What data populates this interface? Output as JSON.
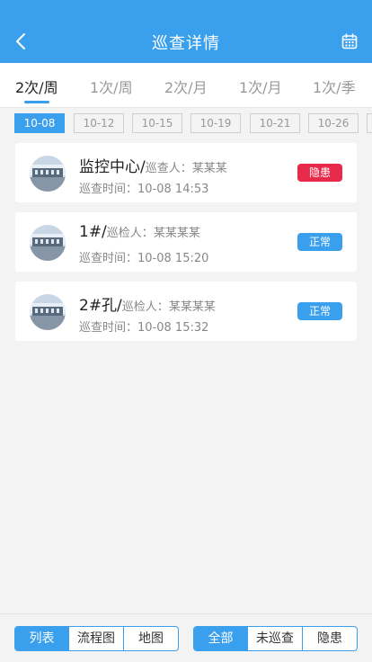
{
  "header": {
    "title": "巡查详情",
    "back_icon": "chevron-left-icon",
    "calendar_icon": "calendar-icon"
  },
  "freq_tabs": [
    "2次/周",
    "1次/周",
    "2次/月",
    "1次/月",
    "1次/季"
  ],
  "active_freq_tab": 0,
  "dates": [
    "10-08",
    "10-12",
    "10-15",
    "10-19",
    "10-21",
    "10-26"
  ],
  "active_date": 0,
  "records": [
    {
      "name": "监控中心/",
      "role_label": "巡查人：",
      "person": "某某某",
      "time_label": "巡查时间：",
      "time": "10-08 14:53",
      "status": "隐患"
    },
    {
      "name": "1#/",
      "role_label": "巡检人：",
      "person": "某某某某",
      "time_label": "巡查时间：",
      "time": "10-08 15:20",
      "status": "正常"
    },
    {
      "name": "2#孔/",
      "role_label": "巡检人：",
      "person": "某某某某",
      "time_label": "巡查时间：",
      "time": "10-08 15:32",
      "status": "正常"
    }
  ],
  "status_colors": {
    "隐患": "#e8294a",
    "正常": "#3aa0ee"
  },
  "view_tabs": [
    "列表",
    "流程图",
    "地图"
  ],
  "filter_tabs": [
    "全部",
    "未巡查",
    "隐患"
  ],
  "colors": {
    "accent": "#3aa0ee",
    "danger": "#e8294a"
  }
}
